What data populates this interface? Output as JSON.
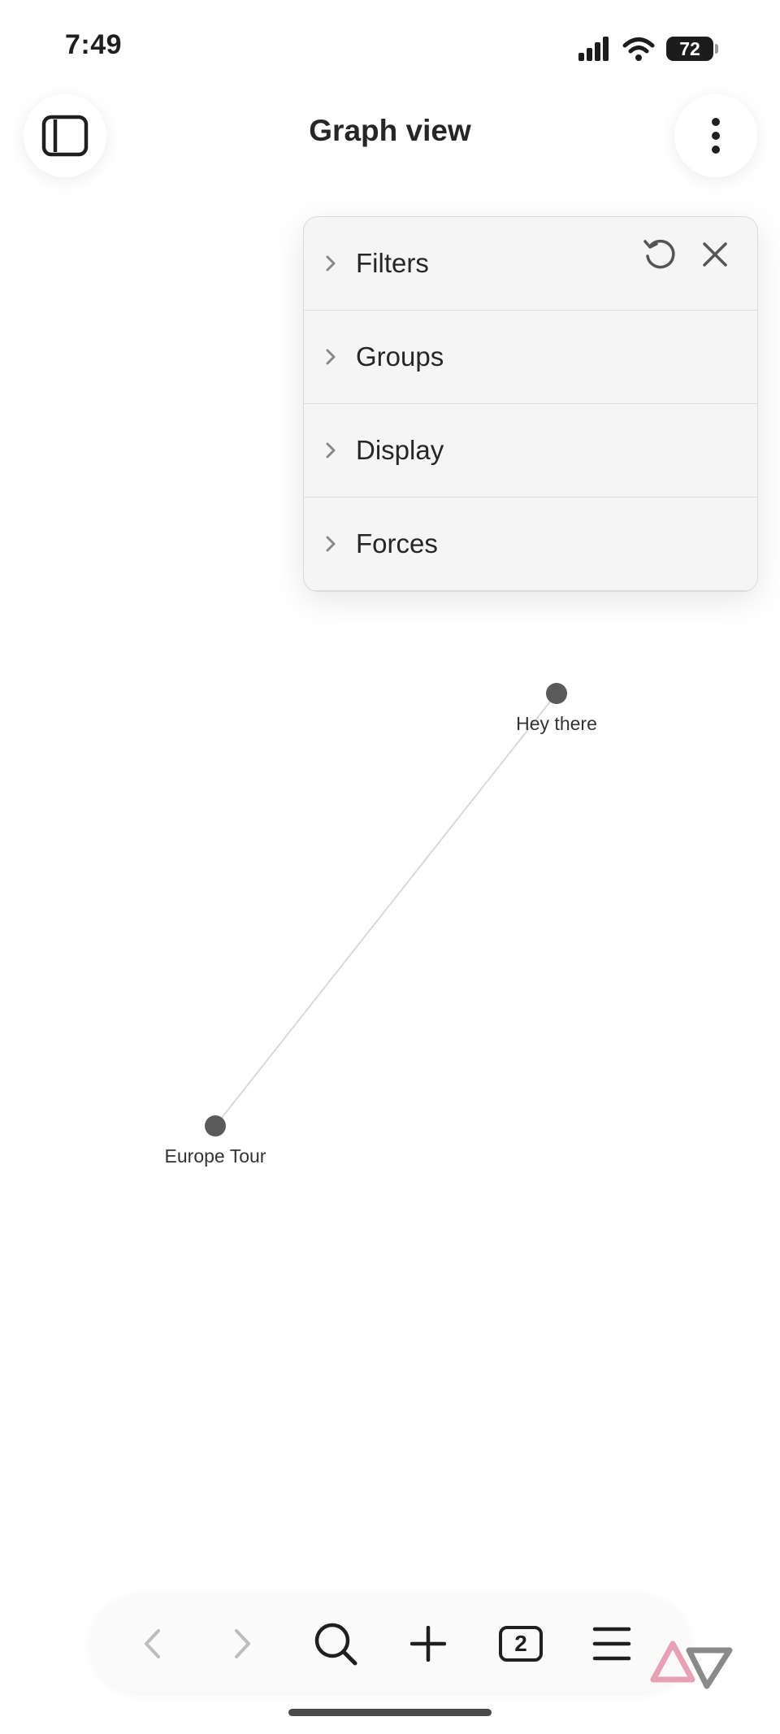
{
  "status_bar": {
    "time": "7:49",
    "battery": "72",
    "icons": [
      "signal-icon",
      "wifi-icon",
      "battery-icon"
    ]
  },
  "header": {
    "title": "Graph view",
    "left_icon": "sidebar-toggle-icon",
    "right_icon": "more-vertical-icon"
  },
  "panel": {
    "sections": [
      {
        "label": "Filters"
      },
      {
        "label": "Groups"
      },
      {
        "label": "Display"
      },
      {
        "label": "Forces"
      }
    ],
    "actions": [
      "reset-icon",
      "close-icon"
    ]
  },
  "graph": {
    "nodes": [
      {
        "id": "n1",
        "label": "Hey there"
      },
      {
        "id": "n2",
        "label": "Europe Tour"
      }
    ],
    "edges": [
      {
        "from": "n1",
        "to": "n2"
      }
    ],
    "node_color": "#5a5a5a",
    "edge_color": "#d9d9d9"
  },
  "bottom_bar": {
    "tab_count": "2",
    "items": [
      "back-icon",
      "forward-icon",
      "search-icon",
      "plus-icon",
      "tabs-icon",
      "menu-icon"
    ]
  },
  "colors": {
    "background": "#ffffff",
    "panel_background": "#f5f5f5",
    "text": "#262626",
    "watermark_pink": "#e8a0b4",
    "watermark_gray": "#8a8a8a"
  }
}
